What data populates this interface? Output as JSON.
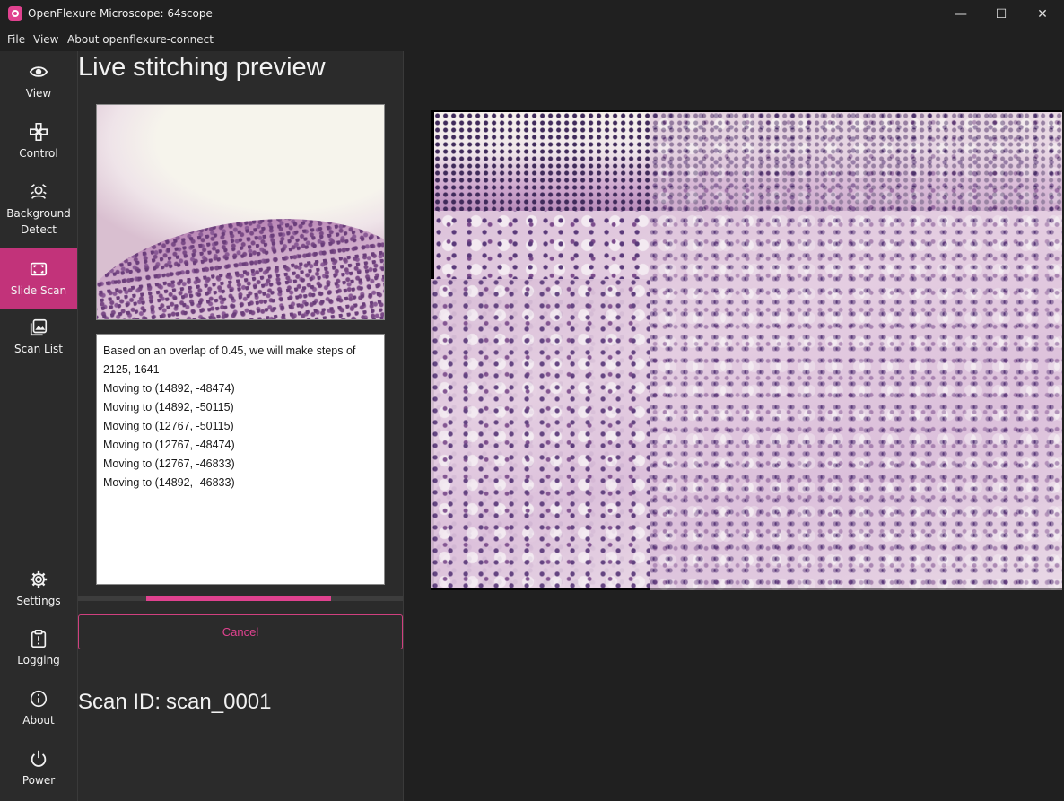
{
  "window": {
    "title": "OpenFlexure Microscope: 64scope",
    "minimize_glyph": "—",
    "maximize_glyph": "☐",
    "close_glyph": "✕"
  },
  "menu": {
    "items": [
      "File",
      "View",
      "About openflexure-connect"
    ]
  },
  "nav": {
    "items": [
      {
        "label": "View",
        "icon": "eye-icon"
      },
      {
        "label": "Control",
        "icon": "gamepad-icon"
      },
      {
        "label": "Background\nDetect",
        "icon": "background-detect-icon"
      },
      {
        "label": "Slide Scan",
        "icon": "slide-scan-icon",
        "active": true
      },
      {
        "label": "Scan List",
        "icon": "image-stack-icon"
      }
    ],
    "bottom_items": [
      {
        "label": "Settings",
        "icon": "gear-icon"
      },
      {
        "label": "Logging",
        "icon": "clipboard-alert-icon"
      },
      {
        "label": "About",
        "icon": "info-icon"
      },
      {
        "label": "Power",
        "icon": "power-icon"
      }
    ]
  },
  "panel": {
    "heading": "Live stitching preview",
    "log_lines": [
      "Based on an overlap of 0.45, we will make steps of 2125, 1641",
      "Moving to (14892, -48474)",
      "Moving to (14892, -50115)",
      "Moving to (12767, -50115)",
      "Moving to (12767, -48474)",
      "Moving to (12767, -46833)",
      "Moving to (14892, -46833)"
    ],
    "progress": {
      "start": 0.21,
      "end": 0.78
    },
    "cancel_label": "Cancel",
    "scan_id_label": "Scan ID:",
    "scan_id_value": "scan_0001"
  },
  "colors": {
    "accent": "#e0428f",
    "nav_active": "#c2337a",
    "background": "#202020",
    "panel": "#2b2b2b"
  }
}
